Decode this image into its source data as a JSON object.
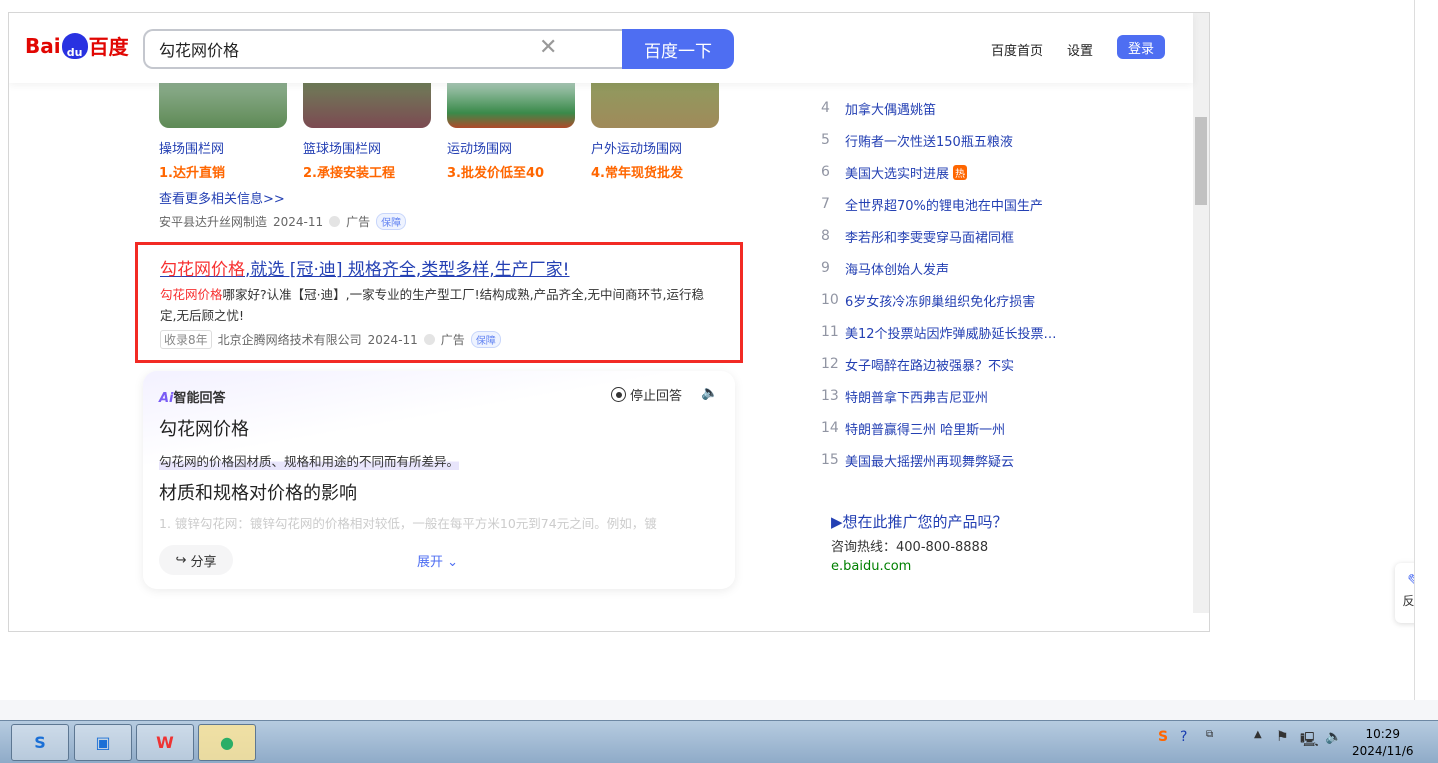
{
  "header": {
    "logo": "Bai百度",
    "search_value": "勾花网价格",
    "search_button": "百度一下",
    "links": [
      "百度首页",
      "设置"
    ],
    "login": "登录"
  },
  "image_ads": [
    {
      "title": "操场围栏网",
      "slogan": "1.达升直销"
    },
    {
      "title": "篮球场围栏网",
      "slogan": "2.承接安装工程"
    },
    {
      "title": "运动场围网",
      "slogan": "3.批发价低至40"
    },
    {
      "title": "户外运动场围网",
      "slogan": "4.常年现货批发"
    }
  ],
  "more_link": "查看更多相关信息>>",
  "ad1_source": {
    "company": "安平县达升丝网制造",
    "date": "2024-11",
    "ad": "广告",
    "badge": "保障"
  },
  "ad2": {
    "title_red": "勾花网价格",
    "title_rest": ",就选 [冠·迪] 规格齐全,类型多样,生产厂家!",
    "desc_red": "勾花网价格",
    "desc_rest": "哪家好?认准【冠·迪】,一家专业的生产型工厂!结构成熟,产品齐全,无中间商环节,运行稳定,无后顾之忧!",
    "tag": "收录8年",
    "company": "北京企腾网络技术有限公司",
    "date": "2024-11",
    "ad": "广告",
    "badge": "保障"
  },
  "ai": {
    "logo_ai": "Ai",
    "logo_text": "智能回答",
    "stop": "停止回答",
    "h1": "勾花网价格",
    "p1": "勾花网的价格因材质、规格和用途的不同而有所差异。",
    "h2": "材质和规格对价格的影响",
    "p2": "1. 镀锌勾花网：镀锌勾花网的价格相对较低，一般在每平方米10元到74元之间。例如，镀",
    "share": "分享",
    "expand": "展开"
  },
  "hot_list": [
    {
      "n": "4",
      "t": "加拿大偶遇姚笛"
    },
    {
      "n": "5",
      "t": "行贿者一次性送150瓶五粮液"
    },
    {
      "n": "6",
      "t": "美国大选实时进展",
      "badge": "热"
    },
    {
      "n": "7",
      "t": "全世界超70%的锂电池在中国生产"
    },
    {
      "n": "8",
      "t": "李若彤和李雯雯穿马面裙同框"
    },
    {
      "n": "9",
      "t": "海马体创始人发声"
    },
    {
      "n": "10",
      "t": "6岁女孩冷冻卵巢组织免化疗损害"
    },
    {
      "n": "11",
      "t": "美12个投票站因炸弹威胁延长投票…"
    },
    {
      "n": "12",
      "t": "女子喝醉在路边被强暴？不实"
    },
    {
      "n": "13",
      "t": "特朗普拿下西弗吉尼亚州"
    },
    {
      "n": "14",
      "t": "特朗普赢得三州 哈里斯一州"
    },
    {
      "n": "15",
      "t": "美国最大摇摆州再现舞弊疑云"
    }
  ],
  "promo": {
    "title": "▶想在此推广您的产品吗？",
    "hotline": "咨询热线：400-800-8888",
    "url": "e.baidu.com"
  },
  "feedback": "反馈",
  "taskbar": {
    "time": "10:29",
    "date": "2024/11/6"
  }
}
